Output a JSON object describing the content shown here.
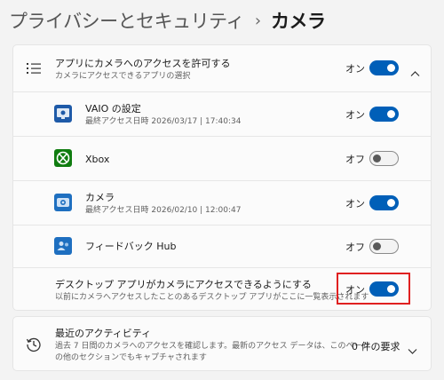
{
  "breadcrumb": {
    "parent": "プライバシーとセキュリティ",
    "separator": "›",
    "current": "カメラ"
  },
  "camera_access": {
    "title": "アプリにカメラへのアクセスを許可する",
    "subtitle": "カメラにアクセスできるアプリの選択",
    "state": "オン",
    "toggle_on": true,
    "icon": "list-icon",
    "chevron": "chevron-up-icon"
  },
  "apps": [
    {
      "name": "VAIO の設定",
      "detail": "最終アクセス日時 2026/03/17 | 17:40:34",
      "state": "オン",
      "toggle_on": true,
      "icon": "vaio-settings-app-icon",
      "color": "#1e5aa8"
    },
    {
      "name": "Xbox",
      "detail": "",
      "state": "オフ",
      "toggle_on": false,
      "icon": "xbox-app-icon",
      "color": "#107c10"
    },
    {
      "name": "カメラ",
      "detail": "最終アクセス日時 2026/02/10 | 12:00:47",
      "state": "オン",
      "toggle_on": true,
      "icon": "camera-app-icon",
      "color": "#1e6fc0"
    },
    {
      "name": "フィードバック Hub",
      "detail": "",
      "state": "オフ",
      "toggle_on": false,
      "icon": "feedback-hub-app-icon",
      "color": "#1e6fc0"
    }
  ],
  "desktop_apps": {
    "title": "デスクトップ アプリがカメラにアクセスできるようにする",
    "subtitle": "以前にカメラへアクセスしたことのあるデスクトップ アプリがここに一覧表示されます",
    "state": "オン",
    "toggle_on": true
  },
  "recent_activity": {
    "title": "最近のアクティビティ",
    "subtitle_line1": "過去 7 日間のカメラへのアクセスを確認します。最新のアクセス データは、このページ",
    "subtitle_line2": "の他のセクションでもキャプチャされます",
    "requests": "0 件の要求",
    "icon": "history-icon",
    "chevron": "chevron-down-icon"
  },
  "colors": {
    "accent": "#005fb8",
    "highlight": "#e02020"
  }
}
